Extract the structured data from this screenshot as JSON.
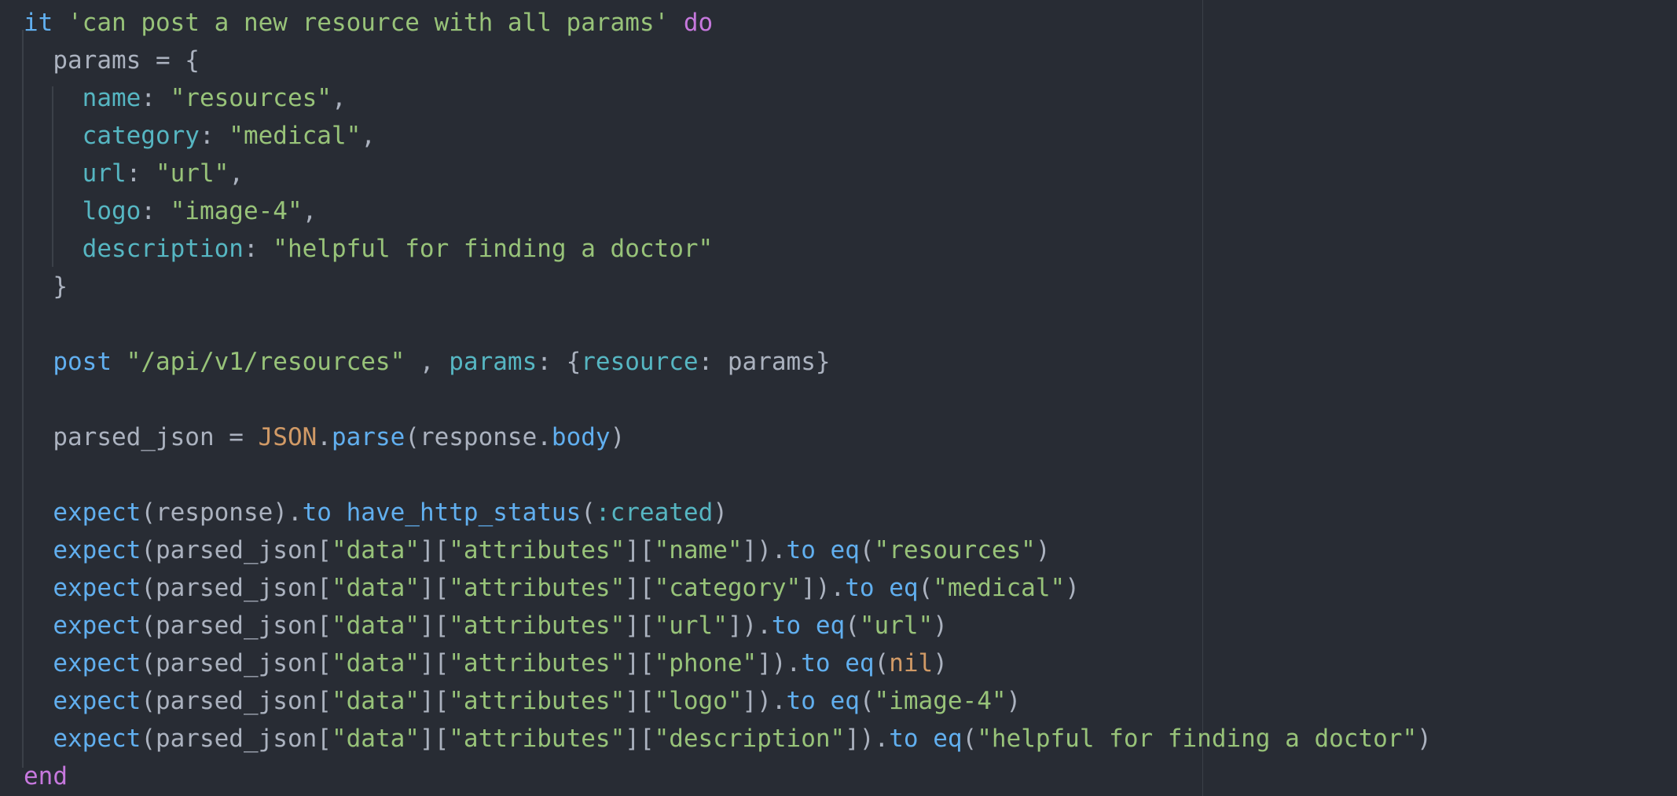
{
  "colors": {
    "background": "#282c34",
    "default": "#abb2bf",
    "keyword": "#c678dd",
    "method": "#61afef",
    "string": "#98c379",
    "symbol": "#56b6c2",
    "constant": "#d19a66",
    "guide": "#3b4048"
  },
  "code": {
    "lines": [
      [
        [
          "method",
          "it"
        ],
        [
          "default",
          " "
        ],
        [
          "string",
          "'can post a new resource with all params'"
        ],
        [
          "default",
          " "
        ],
        [
          "keyword",
          "do"
        ]
      ],
      [
        [
          "default",
          "  params = {"
        ]
      ],
      [
        [
          "default",
          "    "
        ],
        [
          "symbol",
          "name"
        ],
        [
          "default",
          ": "
        ],
        [
          "string",
          "\"resources\""
        ],
        [
          "default",
          ","
        ]
      ],
      [
        [
          "default",
          "    "
        ],
        [
          "symbol",
          "category"
        ],
        [
          "default",
          ": "
        ],
        [
          "string",
          "\"medical\""
        ],
        [
          "default",
          ","
        ]
      ],
      [
        [
          "default",
          "    "
        ],
        [
          "symbol",
          "url"
        ],
        [
          "default",
          ": "
        ],
        [
          "string",
          "\"url\""
        ],
        [
          "default",
          ","
        ]
      ],
      [
        [
          "default",
          "    "
        ],
        [
          "symbol",
          "logo"
        ],
        [
          "default",
          ": "
        ],
        [
          "string",
          "\"image-4\""
        ],
        [
          "default",
          ","
        ]
      ],
      [
        [
          "default",
          "    "
        ],
        [
          "symbol",
          "description"
        ],
        [
          "default",
          ": "
        ],
        [
          "string",
          "\"helpful for finding a doctor\""
        ]
      ],
      [
        [
          "default",
          "  }"
        ]
      ],
      [],
      [
        [
          "default",
          "  "
        ],
        [
          "method",
          "post"
        ],
        [
          "default",
          " "
        ],
        [
          "string",
          "\"/api/v1/resources\""
        ],
        [
          "default",
          " , "
        ],
        [
          "symbol",
          "params"
        ],
        [
          "default",
          ": {"
        ],
        [
          "symbol",
          "resource"
        ],
        [
          "default",
          ": params}"
        ]
      ],
      [],
      [
        [
          "default",
          "  parsed_json = "
        ],
        [
          "constant",
          "JSON"
        ],
        [
          "default",
          "."
        ],
        [
          "method",
          "parse"
        ],
        [
          "default",
          "(response."
        ],
        [
          "method",
          "body"
        ],
        [
          "default",
          ")"
        ]
      ],
      [],
      [
        [
          "default",
          "  "
        ],
        [
          "method",
          "expect"
        ],
        [
          "default",
          "(response)."
        ],
        [
          "method",
          "to"
        ],
        [
          "default",
          " "
        ],
        [
          "method",
          "have_http_status"
        ],
        [
          "default",
          "("
        ],
        [
          "symbol",
          ":created"
        ],
        [
          "default",
          ")"
        ]
      ],
      [
        [
          "default",
          "  "
        ],
        [
          "method",
          "expect"
        ],
        [
          "default",
          "(parsed_json["
        ],
        [
          "string",
          "\"data\""
        ],
        [
          "default",
          "]["
        ],
        [
          "string",
          "\"attributes\""
        ],
        [
          "default",
          "]["
        ],
        [
          "string",
          "\"name\""
        ],
        [
          "default",
          "])."
        ],
        [
          "method",
          "to"
        ],
        [
          "default",
          " "
        ],
        [
          "method",
          "eq"
        ],
        [
          "default",
          "("
        ],
        [
          "string",
          "\"resources\""
        ],
        [
          "default",
          ")"
        ]
      ],
      [
        [
          "default",
          "  "
        ],
        [
          "method",
          "expect"
        ],
        [
          "default",
          "(parsed_json["
        ],
        [
          "string",
          "\"data\""
        ],
        [
          "default",
          "]["
        ],
        [
          "string",
          "\"attributes\""
        ],
        [
          "default",
          "]["
        ],
        [
          "string",
          "\"category\""
        ],
        [
          "default",
          "])."
        ],
        [
          "method",
          "to"
        ],
        [
          "default",
          " "
        ],
        [
          "method",
          "eq"
        ],
        [
          "default",
          "("
        ],
        [
          "string",
          "\"medical\""
        ],
        [
          "default",
          ")"
        ]
      ],
      [
        [
          "default",
          "  "
        ],
        [
          "method",
          "expect"
        ],
        [
          "default",
          "(parsed_json["
        ],
        [
          "string",
          "\"data\""
        ],
        [
          "default",
          "]["
        ],
        [
          "string",
          "\"attributes\""
        ],
        [
          "default",
          "]["
        ],
        [
          "string",
          "\"url\""
        ],
        [
          "default",
          "])."
        ],
        [
          "method",
          "to"
        ],
        [
          "default",
          " "
        ],
        [
          "method",
          "eq"
        ],
        [
          "default",
          "("
        ],
        [
          "string",
          "\"url\""
        ],
        [
          "default",
          ")"
        ]
      ],
      [
        [
          "default",
          "  "
        ],
        [
          "method",
          "expect"
        ],
        [
          "default",
          "(parsed_json["
        ],
        [
          "string",
          "\"data\""
        ],
        [
          "default",
          "]["
        ],
        [
          "string",
          "\"attributes\""
        ],
        [
          "default",
          "]["
        ],
        [
          "string",
          "\"phone\""
        ],
        [
          "default",
          "])."
        ],
        [
          "method",
          "to"
        ],
        [
          "default",
          " "
        ],
        [
          "method",
          "eq"
        ],
        [
          "default",
          "("
        ],
        [
          "constant",
          "nil"
        ],
        [
          "default",
          ")"
        ]
      ],
      [
        [
          "default",
          "  "
        ],
        [
          "method",
          "expect"
        ],
        [
          "default",
          "(parsed_json["
        ],
        [
          "string",
          "\"data\""
        ],
        [
          "default",
          "]["
        ],
        [
          "string",
          "\"attributes\""
        ],
        [
          "default",
          "]["
        ],
        [
          "string",
          "\"logo\""
        ],
        [
          "default",
          "])."
        ],
        [
          "method",
          "to"
        ],
        [
          "default",
          " "
        ],
        [
          "method",
          "eq"
        ],
        [
          "default",
          "("
        ],
        [
          "string",
          "\"image-4\""
        ],
        [
          "default",
          ")"
        ]
      ],
      [
        [
          "default",
          "  "
        ],
        [
          "method",
          "expect"
        ],
        [
          "default",
          "(parsed_json["
        ],
        [
          "string",
          "\"data\""
        ],
        [
          "default",
          "]["
        ],
        [
          "string",
          "\"attributes\""
        ],
        [
          "default",
          "]["
        ],
        [
          "string",
          "\"description\""
        ],
        [
          "default",
          "])."
        ],
        [
          "method",
          "to"
        ],
        [
          "default",
          " "
        ],
        [
          "method",
          "eq"
        ],
        [
          "default",
          "("
        ],
        [
          "string",
          "\"helpful for finding a doctor\""
        ],
        [
          "default",
          ")"
        ]
      ],
      [
        [
          "keyword",
          "end"
        ]
      ]
    ]
  }
}
